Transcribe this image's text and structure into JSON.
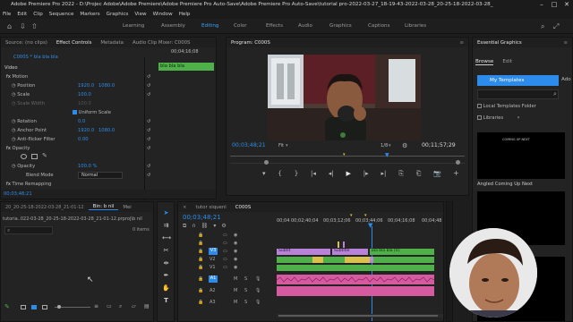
{
  "window": {
    "title": "Adobe Premiere Pro 2022 - D:\\Projec Adobe\\Adobe Premiere\\Adobe Premiere Pro Auto-Save\\Adobe Premiere Pro Auto-Save\\tutorial pro-2022-03-27_18-19-43-2022-03-28_20-25-18-2022-03-28_",
    "controls": [
      "–",
      "□",
      "✕"
    ]
  },
  "menu": [
    "File",
    "Edit",
    "Clip",
    "Sequence",
    "Markers",
    "Graphics",
    "View",
    "Window",
    "Help"
  ],
  "workspaces": [
    "Learning",
    "Assembly",
    "Editing",
    "Color",
    "Effects",
    "Audio",
    "Graphics",
    "Captions",
    "Libraries"
  ],
  "active_workspace": "Editing",
  "effect_controls": {
    "tabs": [
      "Source: (no clips)",
      "Effect Controls",
      "Metadata",
      "Audio Clip Mixer: C000S"
    ],
    "clip_name": "C000S * bla bla bla",
    "timecode_ruler": [
      "00;04;16;08"
    ],
    "clip_chip": "bla bla bla",
    "section_video": "Video",
    "motion": "Motion",
    "position_label": "Position",
    "position_x": "1920.0",
    "position_y": "1080.0",
    "scale_label": "Scale",
    "scale_value": "100.0",
    "scale_width_label": "Scale Width",
    "scale_width_value": "100.0",
    "uniform_scale": "Uniform Scale",
    "rotation_label": "Rotation",
    "rotation_value": "0.0",
    "anchor_label": "Anchor Point",
    "anchor_x": "1920.0",
    "anchor_y": "1080.0",
    "antiflicker_label": "Anti-flicker Filter",
    "antiflicker_value": "0.00",
    "opacity_section": "Opacity",
    "opacity_label": "Opacity",
    "opacity_value": "100.0 %",
    "blend_label": "Blend Mode",
    "blend_value": "Normal",
    "time_remap": "Time Remapping",
    "footer_timecode": "00;03;48;21"
  },
  "program": {
    "title": "Program: C000S",
    "timecode": "00;03;48;21",
    "fit": "Fit",
    "ratio": "1/8",
    "duration": "00;11;57;29",
    "transport": [
      "▾",
      "{",
      "}",
      "|◂",
      "◂|",
      "▶",
      "|▸",
      "▸|",
      "⎘",
      "⎗",
      "📷"
    ]
  },
  "essential_graphics": {
    "title": "Essential Graphics",
    "tabs": [
      "Browse",
      "Edit"
    ],
    "dropdown": "My Templates",
    "dropdown_extra": "Ado",
    "checkbox_local": "Local Templates Folder",
    "checkbox_libraries": "Libraries",
    "template1_caption": "Angled Coming Up Next",
    "template1_text": "COMING UP NEXT"
  },
  "project": {
    "tabs": [
      "Bin: b nil",
      "Mei"
    ],
    "tabbar_title": "20_20-25-18-2022-03-28_21-01-12",
    "file": "tutoria..022-03-28_20-25-18-2022-03-28_21-01-12.prproj\\b nil",
    "items": "0 items"
  },
  "timeline": {
    "tabs": [
      "tutor siquenl",
      "C000S"
    ],
    "timecode": "00;03;48;21",
    "ruler": [
      "00;04",
      "00;02;40;04",
      "00;03;12;06",
      "00;03;44;06",
      "00;04;16;08",
      "00;04;48"
    ],
    "video_tracks": [
      "V3",
      "V2",
      "V1"
    ],
    "audio_tracks": [
      "A1",
      "A2",
      "A3"
    ],
    "clip_labels": [
      "Subtit",
      "Subtitle",
      "bla bla bla [V]",
      "Subti"
    ]
  },
  "colors": {
    "accent": "#2d8ceb",
    "clip_green": "#4fb04a",
    "clip_yellow": "#d8c24b",
    "clip_pink": "#d65aa0",
    "clip_purple": "#b882d8"
  }
}
